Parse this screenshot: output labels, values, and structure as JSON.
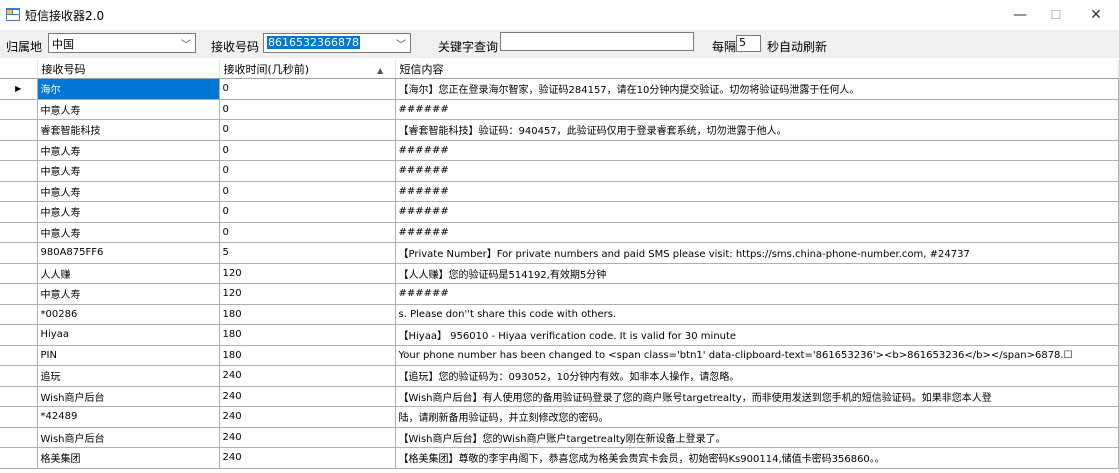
{
  "window": {
    "title": "短信接收器2.0",
    "minimize": "—",
    "maximize": "☐",
    "close": "✕"
  },
  "toolbar": {
    "region_label": "归属地",
    "region_value": "中国",
    "number_label": "接收号码",
    "number_value": "8616532366878",
    "keyword_label": "关键字查询",
    "keyword_value": "",
    "interval_prefix": "每隔",
    "interval_value": "5",
    "interval_suffix": "秒自动刷新"
  },
  "grid": {
    "columns": [
      "接收号码",
      "接收时间(几秒前)",
      "短信内容"
    ],
    "sorted_column": 1,
    "selected_row": 0,
    "rows": [
      [
        "海尔",
        "0",
        "【海尔】您正在登录海尔智家，验证码284157，请在10分钟内提交验证。切勿将验证码泄露于任何人。"
      ],
      [
        "中意人寿",
        "0",
        "######"
      ],
      [
        "睿套智能科技",
        "0",
        "【睿套智能科技】验证码：940457，此验证码仅用于登录睿套系统，切勿泄露于他人。"
      ],
      [
        "中意人寿",
        "0",
        "######"
      ],
      [
        "中意人寿",
        "0",
        "######"
      ],
      [
        "中意人寿",
        "0",
        "######"
      ],
      [
        "中意人寿",
        "0",
        "######"
      ],
      [
        "中意人寿",
        "0",
        "######"
      ],
      [
        "980A875FF6",
        "5",
        "【Private Number】For private numbers and paid SMS please visit:  https://sms.china-phone-number.com, #24737"
      ],
      [
        "人人赚",
        "120",
        "【人人赚】您的验证码是514192,有效期5分钟"
      ],
      [
        "中意人寿",
        "120",
        "######"
      ],
      [
        "*00286",
        "180",
        "s. Please don''t share this code with others."
      ],
      [
        "Hiyaa",
        "180",
        "【Hiyaa】 956010 - Hiyaa verification code. It is valid for 30 minute"
      ],
      [
        "PIN",
        "180",
        "Your phone number has been changed to <span class='btn1' data-clipboard-text='861653236'><b>861653236</b></span>6878.☐"
      ],
      [
        "追玩",
        "240",
        "【追玩】您的验证码为：093052，10分钟内有效。如非本人操作，请忽略。"
      ],
      [
        "Wish商户后台",
        "240",
        "【Wish商户后台】有人使用您的备用验证码登录了您的商户账号targetrealty，而非使用发送到您手机的短信验证码。如果非您本人登"
      ],
      [
        "*42489",
        "240",
        "陆，请刷新备用验证码，并立刻修改您的密码。"
      ],
      [
        "Wish商户后台",
        "240",
        "【Wish商户后台】您的Wish商户账户targetrealty刚在新设备上登录了。"
      ],
      [
        "格美集团",
        "240",
        "【格美集团】尊敬的李宇冉阁下，恭喜您成为格美会贵宾卡会员，初始密码Ks900114,储值卡密码356860。。"
      ]
    ]
  }
}
